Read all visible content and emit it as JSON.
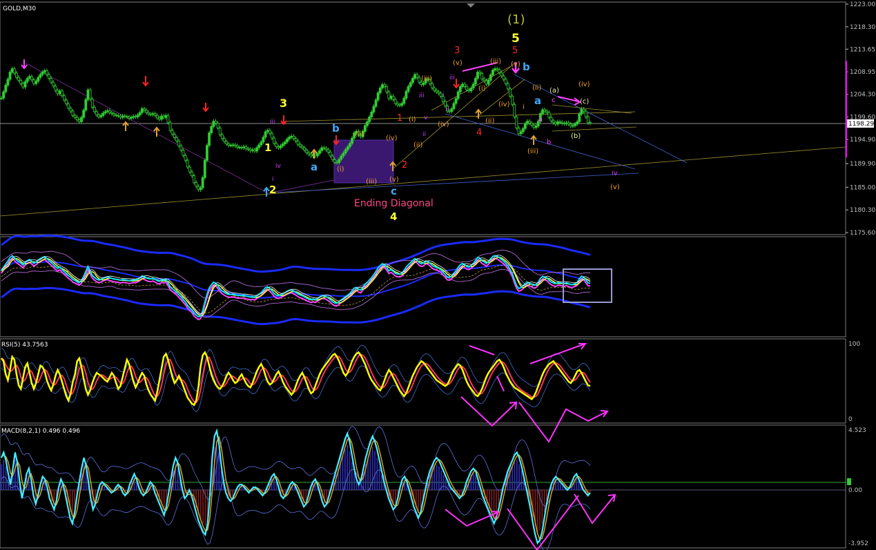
{
  "symbol_label": "GOLD,M30",
  "price_axis": {
    "ticks": [
      "1223.00",
      "1218.30",
      "1213.65",
      "1208.95",
      "1204.30",
      "1199.60",
      "1194.90",
      "1189.90",
      "1185.00",
      "1180.30",
      "1175.60"
    ],
    "current_price": "1198.29",
    "ylim": [
      1175.6,
      1223.0
    ]
  },
  "rsi": {
    "title": "RSI(5) 43.7563",
    "ticks": [
      "100",
      "0"
    ]
  },
  "macd": {
    "title": "MACD(8,2,1) 0.496 0.496",
    "ticks": [
      "4.523",
      "0.00",
      "-3.952"
    ]
  },
  "wave_labels": {
    "cycle": "(1)",
    "five_big": "5",
    "three_big": "3",
    "one_yellow": "1",
    "two_yellow": "2",
    "four_yellow": "4",
    "a_blue_left": "a",
    "b_blue_left": "b",
    "c_blue": "c",
    "a_blue_right": "a",
    "b_blue_right": "b",
    "red3": "3",
    "red5": "5",
    "red1": "1",
    "red2": "2",
    "red4": "4",
    "ending_diagonal": "Ending Diagonal",
    "i_1": "(i)",
    "ii_1": "(ii)",
    "iii_1": "(iii)",
    "iv_1": "(iv)",
    "v_1": "(v)",
    "i_2": "(i)",
    "ii_2": "(ii)",
    "iii_2": "(iii)",
    "iv_2": "(iv)",
    "v_2": "(v)",
    "iii_top": "(iii)",
    "v_top": "(v)",
    "v_top2": "(v)",
    "i_3": "(i)",
    "ii_3": "(ii)",
    "iii_3": "(iii)",
    "iv_3": "(iv)",
    "v_3": "(v)",
    "ii_4": "(ii)",
    "iii_4": "(iii)",
    "a_paren": "(a)",
    "b_paren": "(b)",
    "c_paren": "(c)",
    "iv_paren": "(iv)",
    "small_a": "a",
    "small_b": "b",
    "small_c": "c",
    "iv_small": "iv",
    "v_small": "(v)",
    "iii_small": "iii",
    "iv_small2": "iv",
    "i_small": "i",
    "iii_s2": "iii",
    "ii_s2": "ii",
    "i_s2": "i",
    "v_s2": "v",
    "ii_s3": "ii",
    "iii_s3": "iii",
    "i_s3": "i"
  },
  "colors": {
    "background": "#000000",
    "bull_candle": "#32cd32",
    "text_axis": "#c0c0c0",
    "annotation_pink": "#ff33ff",
    "yellow_label": "#ffff33",
    "blue_label": "#3fa9f5",
    "red_label": "#ff2a2a",
    "orange_label": "#f0a030"
  },
  "chart_data": {
    "type": "line",
    "title": "GOLD,M30",
    "ylim": [
      1175.6,
      1223.0
    ],
    "series": [
      {
        "name": "GOLD,M30",
        "values": [
          1203.5,
          1204.8,
          1206.2,
          1207.4,
          1208.9,
          1209.6,
          1208.7,
          1207.8,
          1207.2,
          1206.5,
          1205.8,
          1206.9,
          1207.6,
          1208.0,
          1207.3,
          1206.5,
          1207.0,
          1207.8,
          1208.4,
          1208.9,
          1209.2,
          1208.4,
          1207.6,
          1206.8,
          1206.0,
          1205.1,
          1204.4,
          1205.0,
          1204.0,
          1203.1,
          1202.3,
          1201.4,
          1200.8,
          1199.9,
          1199.5,
          1199.0,
          1198.6,
          1199.5,
          1201.0,
          1203.2,
          1205.2,
          1203.3,
          1201.6,
          1200.7,
          1200.0,
          1199.6,
          1199.9,
          1200.4,
          1200.7,
          1200.9,
          1200.5,
          1200.3,
          1200.0,
          1199.9,
          1199.8,
          1199.5,
          1199.8,
          1199.7,
          1199.6,
          1199.3,
          1199.5,
          1199.7,
          1199.6,
          1200.0,
          1200.5,
          1201.3,
          1201.0,
          1200.5,
          1200.2,
          1200.1,
          1200.3,
          1199.9,
          1199.4,
          1199.1,
          1199.8,
          1199.5,
          1199.9,
          1198.4,
          1196.8,
          1196.0,
          1195.3,
          1194.6,
          1193.6,
          1192.7,
          1191.6,
          1190.6,
          1189.2,
          1188.2,
          1187.4,
          1186.0,
          1185.2,
          1184.5,
          1184.9,
          1187.0,
          1190.6,
          1193.7,
          1196.3,
          1197.6,
          1198.7,
          1198.3,
          1197.3,
          1195.9,
          1195.1,
          1194.5,
          1194.0,
          1193.7,
          1193.7,
          1193.8,
          1193.6,
          1193.3,
          1193.3,
          1193.2,
          1193.4,
          1193.0,
          1192.9,
          1192.6,
          1192.8,
          1192.5,
          1193.2,
          1193.8,
          1194.4,
          1195.4,
          1196.5,
          1196.8,
          1196.2,
          1195.2,
          1194.1,
          1193.4,
          1193.2,
          1193.6,
          1194.0,
          1194.4,
          1195.0,
          1195.4,
          1195.6,
          1195.1,
          1194.6,
          1193.9,
          1193.5,
          1193.2,
          1192.7,
          1192.2,
          1191.9,
          1191.5,
          1191.8,
          1191.5,
          1192.0,
          1192.6,
          1193.2,
          1193.1,
          1192.8,
          1192.3,
          1191.5,
          1190.7,
          1190.2,
          1190.1,
          1190.8,
          1191.5,
          1192.1,
          1192.8,
          1193.4,
          1194.1,
          1195.2,
          1196.3,
          1196.6,
          1195.8,
          1195.5,
          1196.6,
          1197.8,
          1198.6,
          1199.6,
          1200.6,
          1201.8,
          1203.1,
          1204.6,
          1205.6,
          1206.3,
          1205.9,
          1204.8,
          1203.4,
          1203.9,
          1203.2,
          1202.4,
          1202.1,
          1202.0,
          1202.4,
          1203.5,
          1204.9,
          1205.9,
          1206.7,
          1207.6,
          1208.4,
          1207.8,
          1206.8,
          1206.3,
          1206.6,
          1207.4,
          1207.3,
          1206.5,
          1205.6,
          1205.1,
          1204.8,
          1204.5,
          1203.9,
          1202.8,
          1201.9,
          1200.8,
          1200.7,
          1201.3,
          1202.4,
          1203.4,
          1204.8,
          1205.9,
          1206.4,
          1205.9,
          1205.2,
          1205.0,
          1205.6,
          1206.4,
          1207.6,
          1208.9,
          1208.6,
          1207.5,
          1207.1,
          1206.4,
          1207.2,
          1208.3,
          1209.3,
          1209.6,
          1209.4,
          1208.8,
          1208.1,
          1207.4,
          1206.5,
          1205.4,
          1203.9,
          1202.2,
          1199.6,
          1197.3,
          1196.1,
          1196.5,
          1197.2,
          1198.2,
          1198.7,
          1198.3,
          1197.9,
          1197.4,
          1197.7,
          1198.7,
          1200.3,
          1201.1,
          1200.8,
          1200.5,
          1199.5,
          1198.8,
          1198.4,
          1198.1,
          1198.6,
          1198.5,
          1198.3,
          1198.2,
          1198.4,
          1198.1,
          1197.7,
          1197.8,
          1198.1,
          1198.6,
          1200.2,
          1201.2,
          1200.8,
          1199.6,
          1198.4,
          1198.3
        ]
      }
    ],
    "rsi_values": [
      82,
      78,
      60,
      52,
      66,
      84,
      80,
      60,
      45,
      40,
      55,
      70,
      75,
      62,
      48,
      40,
      48,
      60,
      72,
      70,
      64,
      52,
      44,
      38,
      46,
      58,
      66,
      60,
      50,
      40,
      30,
      24,
      34,
      50,
      60,
      78,
      82,
      70,
      54,
      40,
      32,
      38,
      48,
      56,
      62,
      60,
      58,
      55,
      52,
      50,
      56,
      62,
      58,
      48,
      40,
      44,
      56,
      68,
      80,
      74,
      62,
      50,
      42,
      48,
      56,
      62,
      58,
      46,
      38,
      32,
      28,
      24,
      36,
      52,
      68,
      84,
      88,
      80,
      68,
      56,
      48,
      52,
      58,
      52,
      44,
      36,
      28,
      24,
      20,
      18,
      24,
      42,
      70,
      86,
      90,
      84,
      72,
      60,
      52,
      46,
      42,
      40,
      44,
      50,
      58,
      62,
      58,
      52,
      48,
      50,
      56,
      60,
      54,
      48,
      44,
      42,
      48,
      56,
      64,
      70,
      74,
      68,
      58,
      50,
      46,
      48,
      54,
      60,
      64,
      58,
      50,
      44,
      40,
      36,
      32,
      36,
      44,
      52,
      58,
      62,
      56,
      48,
      40,
      34,
      36,
      44,
      52,
      60,
      66,
      70,
      74,
      78,
      82,
      86,
      88,
      84,
      78,
      70,
      62,
      58,
      62,
      70,
      78,
      84,
      88,
      90,
      86,
      80,
      74,
      66,
      58,
      52,
      48,
      44,
      40,
      38,
      44,
      52,
      60,
      66,
      62,
      56,
      50,
      44,
      38,
      34,
      30,
      34,
      42,
      50,
      58,
      64,
      70,
      74,
      78,
      76,
      72,
      68,
      64,
      60,
      56,
      52,
      50,
      48,
      46,
      44,
      46,
      52,
      60,
      66,
      70,
      74,
      72,
      66,
      58,
      50,
      44,
      40,
      36,
      32,
      30,
      34,
      40,
      48,
      56,
      62,
      66,
      70,
      74,
      78,
      80,
      76,
      70,
      62,
      56,
      50,
      46,
      42,
      40,
      38,
      36,
      34,
      32,
      30,
      28,
      26,
      30,
      36,
      44,
      52,
      60,
      66,
      70,
      74,
      76,
      78,
      74,
      70,
      66,
      62,
      58,
      54,
      50,
      48,
      52,
      58,
      64,
      66,
      62,
      56,
      50,
      45,
      44
    ],
    "macd_values": [
      2.4,
      2.8,
      2.2,
      1.2,
      0.4,
      1.6,
      2.8,
      2.0,
      0.6,
      -0.6,
      0.2,
      1.2,
      1.6,
      0.8,
      -0.4,
      -1.0,
      -0.4,
      0.4,
      1.0,
      0.8,
      0.2,
      -0.6,
      -1.0,
      -1.4,
      -0.8,
      0.2,
      0.8,
      0.4,
      -0.4,
      -1.2,
      -2.0,
      -2.4,
      -1.6,
      -0.4,
      0.6,
      1.6,
      2.4,
      1.8,
      0.6,
      -0.6,
      -1.4,
      -1.0,
      -0.2,
      0.4,
      0.6,
      0.4,
      0.2,
      0.0,
      -0.2,
      -0.1,
      0.2,
      0.4,
      0.2,
      -0.2,
      -0.4,
      -0.2,
      0.4,
      0.8,
      1.2,
      0.8,
      0.2,
      -0.2,
      -0.4,
      -0.2,
      0.2,
      0.6,
      0.4,
      -0.2,
      -0.6,
      -1.0,
      -1.4,
      -1.8,
      -1.2,
      -0.2,
      0.8,
      1.8,
      2.4,
      2.0,
      1.0,
      0.0,
      -0.6,
      -0.4,
      0.0,
      -0.4,
      -1.0,
      -1.6,
      -2.2,
      -2.6,
      -3.0,
      -3.2,
      -2.4,
      -0.4,
      2.4,
      4.0,
      4.4,
      3.4,
      1.8,
      0.6,
      -0.2,
      -0.6,
      -0.8,
      -0.6,
      -0.2,
      0.2,
      0.4,
      0.4,
      0.2,
      0.0,
      -0.2,
      0.0,
      0.2,
      0.2,
      0.0,
      -0.2,
      -0.4,
      -0.2,
      0.2,
      0.6,
      1.0,
      1.2,
      0.8,
      0.2,
      -0.4,
      -0.6,
      -0.4,
      0.0,
      0.4,
      0.6,
      0.4,
      0.0,
      -0.4,
      -0.8,
      -1.2,
      -1.0,
      -0.4,
      0.2,
      0.6,
      0.8,
      0.4,
      -0.2,
      -0.8,
      -1.2,
      -1.0,
      -0.4,
      0.2,
      0.8,
      1.4,
      2.0,
      2.6,
      3.2,
      3.8,
      4.2,
      3.6,
      2.6,
      1.6,
      0.8,
      0.4,
      0.8,
      1.6,
      2.4,
      3.0,
      3.6,
      4.0,
      3.6,
      3.0,
      2.2,
      1.4,
      0.6,
      0.0,
      -0.6,
      -1.0,
      -1.4,
      -1.2,
      -0.6,
      0.2,
      0.8,
      1.0,
      0.6,
      0.0,
      -0.6,
      -1.2,
      -1.6,
      -2.0,
      -1.6,
      -0.8,
      0.0,
      0.8,
      1.4,
      1.8,
      2.2,
      2.4,
      2.2,
      1.8,
      1.4,
      1.0,
      0.6,
      0.2,
      0.0,
      -0.2,
      -0.4,
      -0.6,
      -0.4,
      0.0,
      0.6,
      1.0,
      1.4,
      1.6,
      1.4,
      0.8,
      0.2,
      -0.4,
      -0.8,
      -1.2,
      -1.6,
      -2.0,
      -2.4,
      -2.0,
      -1.4,
      -0.6,
      0.2,
      0.8,
      1.4,
      1.8,
      2.2,
      2.6,
      2.8,
      2.4,
      1.8,
      1.0,
      0.2,
      -0.6,
      -1.4,
      -2.4,
      -3.2,
      -3.8,
      -3.6,
      -3.0,
      -2.0,
      -1.0,
      -0.2,
      0.4,
      0.8,
      1.0,
      0.8,
      0.6,
      0.4,
      0.2,
      0.0,
      0.2,
      0.6,
      1.0,
      1.2,
      0.8,
      0.4,
      0.0,
      -0.2,
      -0.4,
      -0.2
    ]
  }
}
